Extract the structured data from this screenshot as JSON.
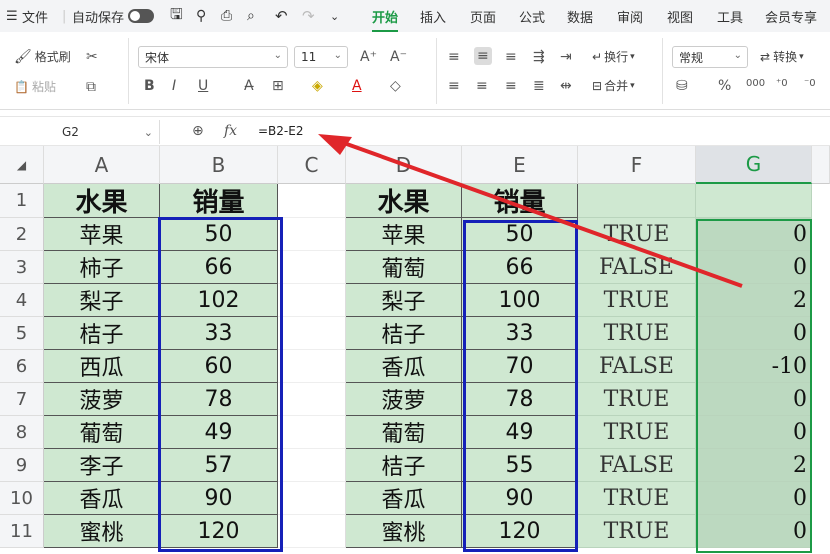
{
  "menubar": {
    "file_label": "文件",
    "autosave_label": "自动保存",
    "tabs": [
      "开始",
      "插入",
      "页面",
      "公式",
      "数据",
      "审阅",
      "视图",
      "工具",
      "会员专享"
    ],
    "active_tab": "开始"
  },
  "ribbon": {
    "format_painter": "格式刷",
    "paste": "粘贴",
    "font_name": "宋体",
    "font_size": "11",
    "wrap": "换行",
    "merge": "合并",
    "number_format": "常规",
    "convert": "转换",
    "bold": "B",
    "italic": "I",
    "underline": "U"
  },
  "formula_bar": {
    "name_box": "G2",
    "fx": "fx",
    "formula": "=B2-E2"
  },
  "columns": [
    "A",
    "B",
    "C",
    "D",
    "E",
    "F",
    "G"
  ],
  "rows": [
    "1",
    "2",
    "3",
    "4",
    "5",
    "6",
    "7",
    "8",
    "9",
    "10",
    "11"
  ],
  "headers": {
    "A": "水果",
    "B": "销量",
    "D": "水果",
    "E": "销量"
  },
  "table": {
    "A": [
      "苹果",
      "柿子",
      "梨子",
      "桔子",
      "西瓜",
      "菠萝",
      "葡萄",
      "李子",
      "香瓜",
      "蜜桃"
    ],
    "B": [
      "50",
      "66",
      "102",
      "33",
      "60",
      "78",
      "49",
      "57",
      "90",
      "120"
    ],
    "D": [
      "苹果",
      "葡萄",
      "梨子",
      "桔子",
      "香瓜",
      "菠萝",
      "葡萄",
      "桔子",
      "香瓜",
      "蜜桃"
    ],
    "E": [
      "50",
      "66",
      "100",
      "33",
      "70",
      "78",
      "49",
      "55",
      "90",
      "120"
    ],
    "F": [
      "TRUE",
      "FALSE",
      "TRUE",
      "TRUE",
      "FALSE",
      "TRUE",
      "TRUE",
      "FALSE",
      "TRUE",
      "TRUE"
    ],
    "G": [
      "0",
      "0",
      "2",
      "0",
      "-10",
      "0",
      "0",
      "2",
      "0",
      "0"
    ]
  },
  "colors": {
    "accent": "#1c9a46",
    "cell_green": "#cfe8d1",
    "box_blue": "#1520b8",
    "arrow_red": "#e0262a"
  }
}
